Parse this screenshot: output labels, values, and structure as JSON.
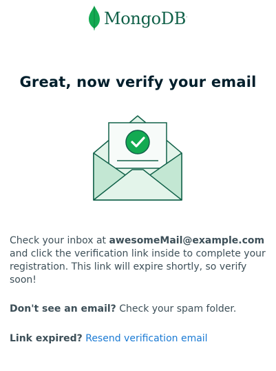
{
  "brand": {
    "name": "MongoDB",
    "trademark": "."
  },
  "heading": "Great, now verify your email",
  "instructions": {
    "prefix": "Check your inbox at ",
    "email": "awesomeMail@example.com",
    "suffix": " and click the verification link inside to complete your registration. This link will expire shortly, so verify soon!"
  },
  "spam_note": {
    "question": "Don't see an email?",
    "answer": " Check your spam folder."
  },
  "expired_note": {
    "question": "Link expired?",
    "link_label": "Resend verification email"
  },
  "colors": {
    "brand_green": "#116149",
    "leaf_green": "#13aa52",
    "link_blue": "#1a7ad4",
    "heading": "#001e2b",
    "body": "#3d4f58"
  },
  "icons": [
    "mongodb-leaf-icon",
    "envelope-check-icon"
  ]
}
